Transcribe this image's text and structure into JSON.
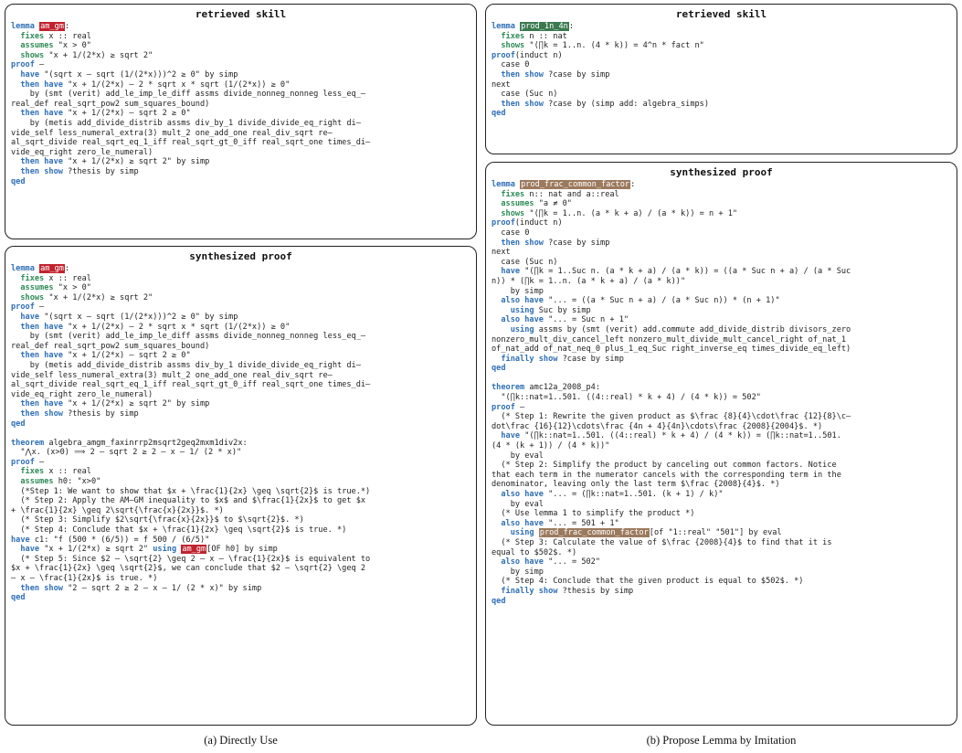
{
  "panel_a_top": {
    "title": "retrieved skill",
    "lines": [
      [
        [
          "b",
          "lemma"
        ],
        [
          "t",
          " "
        ],
        [
          "hr",
          "am_gm"
        ],
        [
          "t",
          ":"
        ]
      ],
      [
        [
          "t",
          "  "
        ],
        [
          "g",
          "fixes"
        ],
        [
          "t",
          " x :: real"
        ]
      ],
      [
        [
          "t",
          "  "
        ],
        [
          "g",
          "assumes"
        ],
        [
          "t",
          " \"x > 0\""
        ]
      ],
      [
        [
          "t",
          "  "
        ],
        [
          "g",
          "shows"
        ],
        [
          "t",
          " \"x + 1/(2*x) ≥ sqrt 2\""
        ]
      ],
      [
        [
          "b",
          "proof"
        ],
        [
          "t",
          " –"
        ]
      ],
      [
        [
          "t",
          "  "
        ],
        [
          "b",
          "have"
        ],
        [
          "t",
          " \"(sqrt x – sqrt (1/(2*x)))^2 ≥ 0\" by simp"
        ]
      ],
      [
        [
          "t",
          "  "
        ],
        [
          "b",
          "then have"
        ],
        [
          "t",
          " \"x + 1/(2*x) – 2 * sqrt x * sqrt (1/(2*x)) ≥ 0\""
        ]
      ],
      [
        [
          "t",
          "    by (smt (verit) add_le_imp_le_diff assms divide_nonneg_nonneg less_eq_–"
        ]
      ],
      [
        [
          "t",
          "real_def real_sqrt_pow2 sum_squares_bound)"
        ]
      ],
      [
        [
          "t",
          "  "
        ],
        [
          "b",
          "then have"
        ],
        [
          "t",
          " \"x + 1/(2*x) – sqrt 2 ≥ 0\""
        ]
      ],
      [
        [
          "t",
          "    by (metis add_divide_distrib assms div_by_1 divide_divide_eq_right di–"
        ]
      ],
      [
        [
          "t",
          "vide_self less_numeral_extra(3) mult_2 one_add_one real_div_sqrt re–"
        ]
      ],
      [
        [
          "t",
          "al_sqrt_divide real_sqrt_eq_1_iff real_sqrt_gt_0_iff real_sqrt_one times_di–"
        ]
      ],
      [
        [
          "t",
          "vide_eq_right zero_le_numeral)"
        ]
      ],
      [
        [
          "t",
          "  "
        ],
        [
          "b",
          "then have"
        ],
        [
          "t",
          " \"x + 1/(2*x) ≥ sqrt 2\" by simp"
        ]
      ],
      [
        [
          "t",
          "  "
        ],
        [
          "b",
          "then show"
        ],
        [
          "t",
          " ?thesis by simp"
        ]
      ],
      [
        [
          "b",
          "qed"
        ]
      ]
    ]
  },
  "panel_a_bottom": {
    "title": "synthesized proof",
    "lines": [
      [
        [
          "b",
          "lemma"
        ],
        [
          "t",
          " "
        ],
        [
          "hr",
          "am_gm"
        ],
        [
          "t",
          ":"
        ]
      ],
      [
        [
          "t",
          "  "
        ],
        [
          "g",
          "fixes"
        ],
        [
          "t",
          " x :: real"
        ]
      ],
      [
        [
          "t",
          "  "
        ],
        [
          "g",
          "assumes"
        ],
        [
          "t",
          " \"x > 0\""
        ]
      ],
      [
        [
          "t",
          "  "
        ],
        [
          "g",
          "shows"
        ],
        [
          "t",
          " \"x + 1/(2*x) ≥ sqrt 2\""
        ]
      ],
      [
        [
          "b",
          "proof"
        ],
        [
          "t",
          " –"
        ]
      ],
      [
        [
          "t",
          "  "
        ],
        [
          "b",
          "have"
        ],
        [
          "t",
          " \"(sqrt x – sqrt (1/(2*x)))^2 ≥ 0\" by simp"
        ]
      ],
      [
        [
          "t",
          "  "
        ],
        [
          "b",
          "then have"
        ],
        [
          "t",
          " \"x + 1/(2*x) – 2 * sqrt x * sqrt (1/(2*x)) ≥ 0\""
        ]
      ],
      [
        [
          "t",
          "    by (smt (verit) add_le_imp_le_diff assms divide_nonneg_nonneg less_eq_–"
        ]
      ],
      [
        [
          "t",
          "real_def real_sqrt_pow2 sum_squares_bound)"
        ]
      ],
      [
        [
          "t",
          "  "
        ],
        [
          "b",
          "then have"
        ],
        [
          "t",
          " \"x + 1/(2*x) – sqrt 2 ≥ 0\""
        ]
      ],
      [
        [
          "t",
          "    by (metis add_divide_distrib assms div_by_1 divide_divide_eq_right di–"
        ]
      ],
      [
        [
          "t",
          "vide_self less_numeral_extra(3) mult_2 one_add_one real_div_sqrt re–"
        ]
      ],
      [
        [
          "t",
          "al_sqrt_divide real_sqrt_eq_1_iff real_sqrt_gt_0_iff real_sqrt_one times_di–"
        ]
      ],
      [
        [
          "t",
          "vide_eq_right zero_le_numeral)"
        ]
      ],
      [
        [
          "t",
          "  "
        ],
        [
          "b",
          "then have"
        ],
        [
          "t",
          " \"x + 1/(2*x) ≥ sqrt 2\" by simp"
        ]
      ],
      [
        [
          "t",
          "  "
        ],
        [
          "b",
          "then show"
        ],
        [
          "t",
          " ?thesis by simp"
        ]
      ],
      [
        [
          "b",
          "qed"
        ]
      ],
      [
        [
          "t",
          ""
        ]
      ],
      [
        [
          "b",
          "theorem"
        ],
        [
          "t",
          " algebra_amgm_faxinrrp2msqrt2geq2mxm1div2x:"
        ]
      ],
      [
        [
          "t",
          "  \"⋀x. (x>0) ⟹ 2 – sqrt 2 ≥ 2 – x – 1/ (2 * x)\""
        ]
      ],
      [
        [
          "b",
          "proof"
        ],
        [
          "t",
          " –"
        ]
      ],
      [
        [
          "t",
          "  "
        ],
        [
          "g",
          "fixes"
        ],
        [
          "t",
          " x :: real"
        ]
      ],
      [
        [
          "t",
          "  "
        ],
        [
          "g",
          "assumes"
        ],
        [
          "t",
          " h0: \"x>0\""
        ]
      ],
      [
        [
          "t",
          "  (*Step 1: We want to show that $x + \\frac{1}{2x} \\geq \\sqrt{2}$ is true.*)"
        ]
      ],
      [
        [
          "t",
          "  (* Step 2: Apply the AM–GM inequality to $x$ and $\\frac{1}{2x}$ to get $x"
        ]
      ],
      [
        [
          "t",
          "+ \\frac{1}{2x} \\geq 2\\sqrt{\\frac{x}{2x}}$. *)"
        ]
      ],
      [
        [
          "t",
          "  (* Step 3: Simplify $2\\sqrt{\\frac{x}{2x}}$ to $\\sqrt{2}$. *)"
        ]
      ],
      [
        [
          "t",
          "  (* Step 4: Conclude that $x + \\frac{1}{2x} \\geq \\sqrt{2}$ is true. *)"
        ]
      ],
      [
        [
          "b",
          "have"
        ],
        [
          "t",
          " c1: \"f (500 * (6/5)) = f 500 / (6/5)\""
        ]
      ],
      [
        [
          "t",
          "  "
        ],
        [
          "b",
          "have"
        ],
        [
          "t",
          " \"x + 1/(2*x) ≥ sqrt 2\" "
        ],
        [
          "b",
          "using"
        ],
        [
          "t",
          " "
        ],
        [
          "hr",
          "am_gm"
        ],
        [
          "t",
          "[OF h0] by simp"
        ]
      ],
      [
        [
          "t",
          "  (* Step 5: Since $2 – \\sqrt{2} \\geq 2 – x – \\frac{1}{2x}$ is equivalent to"
        ]
      ],
      [
        [
          "t",
          "$x + \\frac{1}{2x} \\geq \\sqrt{2}$, we can conclude that $2 – \\sqrt{2} \\geq 2"
        ]
      ],
      [
        [
          "t",
          "– x – \\frac{1}{2x}$ is true. *)"
        ]
      ],
      [
        [
          "t",
          "  "
        ],
        [
          "b",
          "then show"
        ],
        [
          "t",
          " \"2 – sqrt 2 ≥ 2 – x – 1/ (2 * x)\" by simp"
        ]
      ],
      [
        [
          "b",
          "qed"
        ]
      ]
    ]
  },
  "panel_b_top": {
    "title": "retrieved skill",
    "lines": [
      [
        [
          "b",
          "lemma"
        ],
        [
          "t",
          " "
        ],
        [
          "hg",
          "prod_1n_4n"
        ],
        [
          "t",
          ":"
        ]
      ],
      [
        [
          "t",
          "  "
        ],
        [
          "g",
          "fixes"
        ],
        [
          "t",
          " n :: nat"
        ]
      ],
      [
        [
          "t",
          "  "
        ],
        [
          "g",
          "shows"
        ],
        [
          "t",
          " \"(∏k = 1..n. (4 * k)) = 4^n * fact n\""
        ]
      ],
      [
        [
          "b",
          "proof"
        ],
        [
          "t",
          "(induct n)"
        ]
      ],
      [
        [
          "t",
          "  case 0"
        ]
      ],
      [
        [
          "t",
          "  "
        ],
        [
          "b",
          "then show"
        ],
        [
          "t",
          " ?case by simp"
        ]
      ],
      [
        [
          "t",
          "next"
        ]
      ],
      [
        [
          "t",
          "  case (Suc n)"
        ]
      ],
      [
        [
          "t",
          "  "
        ],
        [
          "b",
          "then show"
        ],
        [
          "t",
          " ?case by (simp add: algebra_simps)"
        ]
      ],
      [
        [
          "b",
          "qed"
        ]
      ]
    ]
  },
  "panel_b_bottom": {
    "title": "synthesized proof",
    "lines": [
      [
        [
          "b",
          "lemma"
        ],
        [
          "t",
          " "
        ],
        [
          "hb",
          "prod_frac_common_factor"
        ],
        [
          "t",
          ":"
        ]
      ],
      [
        [
          "t",
          "  "
        ],
        [
          "g",
          "fixes"
        ],
        [
          "t",
          " n:: nat and a::real"
        ]
      ],
      [
        [
          "t",
          "  "
        ],
        [
          "g",
          "assumes"
        ],
        [
          "t",
          " \"a ≠ 0\""
        ]
      ],
      [
        [
          "t",
          "  "
        ],
        [
          "g",
          "shows"
        ],
        [
          "t",
          " \"(∏k = 1..n. (a * k + a) / (a * k)) = n + 1\""
        ]
      ],
      [
        [
          "b",
          "proof"
        ],
        [
          "t",
          "(induct n)"
        ]
      ],
      [
        [
          "t",
          "  case 0"
        ]
      ],
      [
        [
          "t",
          "  "
        ],
        [
          "b",
          "then show"
        ],
        [
          "t",
          " ?case by simp"
        ]
      ],
      [
        [
          "t",
          "next"
        ]
      ],
      [
        [
          "t",
          "  case (Suc n)"
        ]
      ],
      [
        [
          "t",
          "  "
        ],
        [
          "b",
          "have"
        ],
        [
          "t",
          " \"(∏k = 1..Suc n. (a * k + a) / (a * k)) = ((a * Suc n + a) / (a * Suc"
        ]
      ],
      [
        [
          "t",
          "n)) * (∏k = 1..n. (a * k + a) / (a * k))\""
        ]
      ],
      [
        [
          "t",
          "    by simp"
        ]
      ],
      [
        [
          "t",
          "  "
        ],
        [
          "b",
          "also have"
        ],
        [
          "t",
          " \"... = ((a * Suc n + a) / (a * Suc n)) * (n + 1)\""
        ]
      ],
      [
        [
          "t",
          "    "
        ],
        [
          "b",
          "using"
        ],
        [
          "t",
          " Suc by simp"
        ]
      ],
      [
        [
          "t",
          "  "
        ],
        [
          "b",
          "also have"
        ],
        [
          "t",
          " \"... = Suc n + 1\""
        ]
      ],
      [
        [
          "t",
          "    "
        ],
        [
          "b",
          "using"
        ],
        [
          "t",
          " assms by (smt (verit) add.commute add_divide_distrib divisors_zero"
        ]
      ],
      [
        [
          "t",
          "nonzero_mult_div_cancel_left nonzero_mult_divide_mult_cancel_right of_nat_1"
        ]
      ],
      [
        [
          "t",
          "of_nat_add of_nat_neq_0 plus_1_eq_Suc right_inverse_eq times_divide_eq_left)"
        ]
      ],
      [
        [
          "t",
          "  "
        ],
        [
          "b",
          "finally show"
        ],
        [
          "t",
          " ?case by simp"
        ]
      ],
      [
        [
          "b",
          "qed"
        ]
      ],
      [
        [
          "t",
          ""
        ]
      ],
      [
        [
          "b",
          "theorem"
        ],
        [
          "t",
          " amc12a_2008_p4:"
        ]
      ],
      [
        [
          "t",
          "  \"(∏k::nat=1..501. ((4::real) * k + 4) / (4 * k)) = 502\""
        ]
      ],
      [
        [
          "b",
          "proof"
        ],
        [
          "t",
          " –"
        ]
      ],
      [
        [
          "t",
          "  (* Step 1: Rewrite the given product as $\\frac {8}{4}\\cdot\\frac {12}{8}\\c–"
        ]
      ],
      [
        [
          "t",
          "dot\\frac {16}{12}\\cdots\\frac {4n + 4}{4n}\\cdots\\frac {2008}{2004}$. *)"
        ]
      ],
      [
        [
          "t",
          "  "
        ],
        [
          "b",
          "have"
        ],
        [
          "t",
          " \"(∏k::nat=1..501. ((4::real) * k + 4) / (4 * k)) = (∏k::nat=1..501."
        ]
      ],
      [
        [
          "t",
          "(4 * (k + 1)) / (4 * k))\""
        ]
      ],
      [
        [
          "t",
          "    by eval"
        ]
      ],
      [
        [
          "t",
          "  (* Step 2: Simplify the product by canceling out common factors. Notice"
        ]
      ],
      [
        [
          "t",
          "that each term in the numerator cancels with the corresponding term in the"
        ]
      ],
      [
        [
          "t",
          "denominator, leaving only the last term $\\frac {2008}{4}$. *)"
        ]
      ],
      [
        [
          "t",
          "  "
        ],
        [
          "b",
          "also have"
        ],
        [
          "t",
          " \"... = (∏k::nat=1..501. (k + 1) / k)\""
        ]
      ],
      [
        [
          "t",
          "    by eval"
        ]
      ],
      [
        [
          "t",
          "  (* Use lemma 1 to simplify the product *)"
        ]
      ],
      [
        [
          "t",
          "  "
        ],
        [
          "b",
          "also have"
        ],
        [
          "t",
          " \"... = 501 + 1\""
        ]
      ],
      [
        [
          "t",
          "    "
        ],
        [
          "b",
          "using"
        ],
        [
          "t",
          " "
        ],
        [
          "hb",
          "prod_frac_common_factor"
        ],
        [
          "t",
          "[of \"1::real\" \"501\"] by eval"
        ]
      ],
      [
        [
          "t",
          "  (* Step 3: Calculate the value of $\\frac {2008}{4}$ to find that it is"
        ]
      ],
      [
        [
          "t",
          "equal to $502$. *)"
        ]
      ],
      [
        [
          "t",
          "  "
        ],
        [
          "b",
          "also have"
        ],
        [
          "t",
          " \"... = 502\""
        ]
      ],
      [
        [
          "t",
          "    by simp"
        ]
      ],
      [
        [
          "t",
          "  (* Step 4: Conclude that the given product is equal to $502$. *)"
        ]
      ],
      [
        [
          "t",
          "  "
        ],
        [
          "b",
          "finally show"
        ],
        [
          "t",
          " ?thesis by simp"
        ]
      ],
      [
        [
          "b",
          "qed"
        ]
      ]
    ]
  },
  "captions": {
    "a": "(a) Directly Use",
    "b": "(b) Propose Lemma by Imitation"
  }
}
